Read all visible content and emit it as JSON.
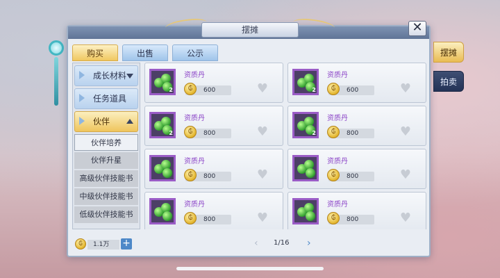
{
  "window": {
    "title": "摆摊",
    "close_glyph": "✕"
  },
  "tabs": [
    {
      "label": "购买",
      "active": true
    },
    {
      "label": "出售",
      "active": false
    },
    {
      "label": "公示",
      "active": false
    }
  ],
  "sidebar": {
    "categories": [
      {
        "label": "成长材料"
      },
      {
        "label": "任务道具"
      },
      {
        "label": "伙伴"
      }
    ],
    "subitems": [
      {
        "label": "伙伴培养"
      },
      {
        "label": "伙伴升星"
      },
      {
        "label": "高级伙伴技能书"
      },
      {
        "label": "中级伙伴技能书"
      },
      {
        "label": "低级伙伴技能书"
      }
    ]
  },
  "items": [
    {
      "name": "资质丹",
      "qty": "2",
      "price": "600"
    },
    {
      "name": "资质丹",
      "qty": "2",
      "price": "600"
    },
    {
      "name": "资质丹",
      "qty": "2",
      "price": "800"
    },
    {
      "name": "资质丹",
      "qty": "2",
      "price": "800"
    },
    {
      "name": "资质丹",
      "qty": "",
      "price": "800"
    },
    {
      "name": "资质丹",
      "qty": "",
      "price": "800"
    },
    {
      "name": "资质丹",
      "qty": "",
      "price": "800"
    },
    {
      "name": "资质丹",
      "qty": "",
      "price": "800"
    }
  ],
  "footer": {
    "balance": "1.1万",
    "add_glyph": "+",
    "prev_glyph": "‹",
    "next_glyph": "›",
    "page": "1/16"
  },
  "side_tabs": [
    {
      "label": "摆摊"
    },
    {
      "label": "拍卖"
    }
  ],
  "icons": {
    "coin": "coin-icon",
    "heart": "heart-icon",
    "item": "green-pill-icon"
  },
  "colors": {
    "item_name": "#8d47c8",
    "active_tab": "#f0c760",
    "accent_blue": "#4d88c8"
  }
}
